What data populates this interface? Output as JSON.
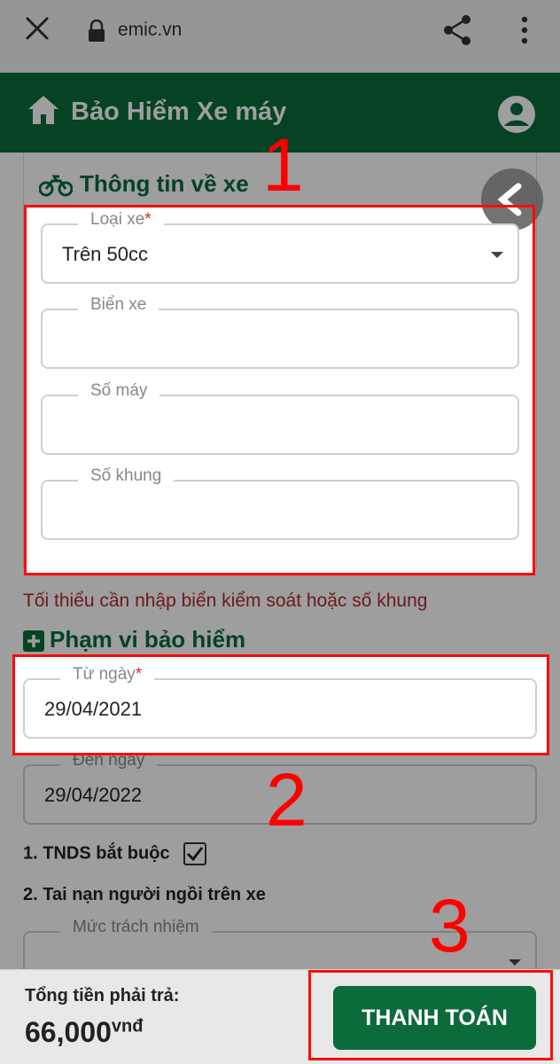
{
  "browser": {
    "url": "emic.vn"
  },
  "header": {
    "title": "Bảo Hiểm Xe máy"
  },
  "vehicle_section": {
    "title": "Thông tin về xe",
    "fields": {
      "vehicle_type": {
        "label": "Loại xe",
        "required": "*",
        "value": "Trên 50cc"
      },
      "plate": {
        "label": "Biển xe",
        "value": ""
      },
      "engine_no": {
        "label": "Số máy",
        "value": ""
      },
      "chassis_no": {
        "label": "Số khung",
        "value": ""
      }
    },
    "warning": "Tối thiểu cần nhập biển kiểm soát hoặc số khung"
  },
  "coverage_section": {
    "title": "Phạm vi bảo hiểm",
    "from_date": {
      "label": "Từ ngày",
      "required": "*",
      "value": "29/04/2021"
    },
    "to_date": {
      "label": "Đến ngày",
      "value": "29/04/2022"
    },
    "options": {
      "tnds": {
        "label": "1. TNDS bắt buộc",
        "checked": true
      },
      "accident": {
        "label": "2. Tai nạn người ngồi trên xe"
      }
    },
    "liability": {
      "label": "Mức trách nhiệm",
      "value": ""
    }
  },
  "footer": {
    "total_label": "Tổng tiền phải trả:",
    "total_value": "66,000",
    "total_unit": "vnđ",
    "pay_button": "THANH TOÁN"
  },
  "annotations": {
    "step1": "1",
    "step2": "2",
    "step3": "3",
    "color": "#ff0000"
  },
  "colors": {
    "brand_green": "#0b6b3a",
    "warning_red": "#b22a2a"
  }
}
